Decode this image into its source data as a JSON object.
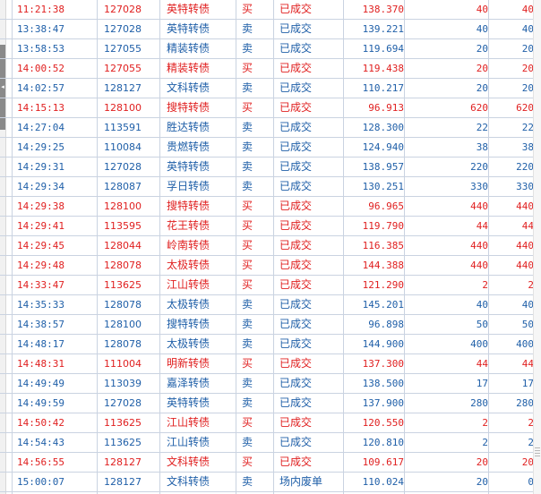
{
  "colors": {
    "buy": "#e02020",
    "sell": "#1f5fa8",
    "grid_line": "#cad3e1"
  },
  "columns": [
    "time",
    "code",
    "name",
    "direction",
    "status",
    "price",
    "quantity",
    "filled"
  ],
  "rows": [
    {
      "time": "11:21:38",
      "code": "127028",
      "name": "英特转债",
      "direction": "买",
      "status": "已成交",
      "price": "138.370",
      "quantity": "40",
      "filled": "40",
      "side": "buy"
    },
    {
      "time": "13:38:47",
      "code": "127028",
      "name": "英特转债",
      "direction": "卖",
      "status": "已成交",
      "price": "139.221",
      "quantity": "40",
      "filled": "40",
      "side": "sell"
    },
    {
      "time": "13:58:53",
      "code": "127055",
      "name": "精装转债",
      "direction": "卖",
      "status": "已成交",
      "price": "119.694",
      "quantity": "20",
      "filled": "20",
      "side": "sell"
    },
    {
      "time": "14:00:52",
      "code": "127055",
      "name": "精装转债",
      "direction": "买",
      "status": "已成交",
      "price": "119.438",
      "quantity": "20",
      "filled": "20",
      "side": "buy"
    },
    {
      "time": "14:02:57",
      "code": "128127",
      "name": "文科转债",
      "direction": "卖",
      "status": "已成交",
      "price": "110.217",
      "quantity": "20",
      "filled": "20",
      "side": "sell"
    },
    {
      "time": "14:15:13",
      "code": "128100",
      "name": "搜特转债",
      "direction": "买",
      "status": "已成交",
      "price": "96.913",
      "quantity": "620",
      "filled": "620",
      "side": "buy"
    },
    {
      "time": "14:27:04",
      "code": "113591",
      "name": "胜达转债",
      "direction": "卖",
      "status": "已成交",
      "price": "128.300",
      "quantity": "22",
      "filled": "22",
      "side": "sell"
    },
    {
      "time": "14:29:25",
      "code": "110084",
      "name": "贵燃转债",
      "direction": "卖",
      "status": "已成交",
      "price": "124.940",
      "quantity": "38",
      "filled": "38",
      "side": "sell"
    },
    {
      "time": "14:29:31",
      "code": "127028",
      "name": "英特转债",
      "direction": "卖",
      "status": "已成交",
      "price": "138.957",
      "quantity": "220",
      "filled": "220",
      "side": "sell"
    },
    {
      "time": "14:29:34",
      "code": "128087",
      "name": "孚日转债",
      "direction": "卖",
      "status": "已成交",
      "price": "130.251",
      "quantity": "330",
      "filled": "330",
      "side": "sell"
    },
    {
      "time": "14:29:38",
      "code": "128100",
      "name": "搜特转债",
      "direction": "买",
      "status": "已成交",
      "price": "96.965",
      "quantity": "440",
      "filled": "440",
      "side": "buy"
    },
    {
      "time": "14:29:41",
      "code": "113595",
      "name": "花王转债",
      "direction": "买",
      "status": "已成交",
      "price": "119.790",
      "quantity": "44",
      "filled": "44",
      "side": "buy"
    },
    {
      "time": "14:29:45",
      "code": "128044",
      "name": "岭南转债",
      "direction": "买",
      "status": "已成交",
      "price": "116.385",
      "quantity": "440",
      "filled": "440",
      "side": "buy"
    },
    {
      "time": "14:29:48",
      "code": "128078",
      "name": "太极转债",
      "direction": "买",
      "status": "已成交",
      "price": "144.388",
      "quantity": "440",
      "filled": "440",
      "side": "buy"
    },
    {
      "time": "14:33:47",
      "code": "113625",
      "name": "江山转债",
      "direction": "买",
      "status": "已成交",
      "price": "121.290",
      "quantity": "2",
      "filled": "2",
      "side": "buy"
    },
    {
      "time": "14:35:33",
      "code": "128078",
      "name": "太极转债",
      "direction": "卖",
      "status": "已成交",
      "price": "145.201",
      "quantity": "40",
      "filled": "40",
      "side": "sell"
    },
    {
      "time": "14:38:57",
      "code": "128100",
      "name": "搜特转债",
      "direction": "卖",
      "status": "已成交",
      "price": "96.898",
      "quantity": "50",
      "filled": "50",
      "side": "sell"
    },
    {
      "time": "14:48:17",
      "code": "128078",
      "name": "太极转债",
      "direction": "卖",
      "status": "已成交",
      "price": "144.900",
      "quantity": "400",
      "filled": "400",
      "side": "sell"
    },
    {
      "time": "14:48:31",
      "code": "111004",
      "name": "明新转债",
      "direction": "买",
      "status": "已成交",
      "price": "137.300",
      "quantity": "44",
      "filled": "44",
      "side": "buy"
    },
    {
      "time": "14:49:49",
      "code": "113039",
      "name": "嘉泽转债",
      "direction": "卖",
      "status": "已成交",
      "price": "138.500",
      "quantity": "17",
      "filled": "17",
      "side": "sell"
    },
    {
      "time": "14:49:59",
      "code": "127028",
      "name": "英特转债",
      "direction": "卖",
      "status": "已成交",
      "price": "137.900",
      "quantity": "280",
      "filled": "280",
      "side": "sell"
    },
    {
      "time": "14:50:42",
      "code": "113625",
      "name": "江山转债",
      "direction": "买",
      "status": "已成交",
      "price": "120.550",
      "quantity": "2",
      "filled": "2",
      "side": "buy"
    },
    {
      "time": "14:54:43",
      "code": "113625",
      "name": "江山转债",
      "direction": "卖",
      "status": "已成交",
      "price": "120.810",
      "quantity": "2",
      "filled": "2",
      "side": "sell"
    },
    {
      "time": "14:56:55",
      "code": "128127",
      "name": "文科转债",
      "direction": "买",
      "status": "已成交",
      "price": "109.617",
      "quantity": "20",
      "filled": "20",
      "side": "buy"
    },
    {
      "time": "15:00:07",
      "code": "128127",
      "name": "文科转债",
      "direction": "卖",
      "status": "场内废单",
      "price": "110.024",
      "quantity": "20",
      "filled": "0",
      "side": "cancel"
    }
  ],
  "splitter": {
    "arrow_icon": "triangle-left-icon",
    "arrow_glyph": "◂"
  }
}
